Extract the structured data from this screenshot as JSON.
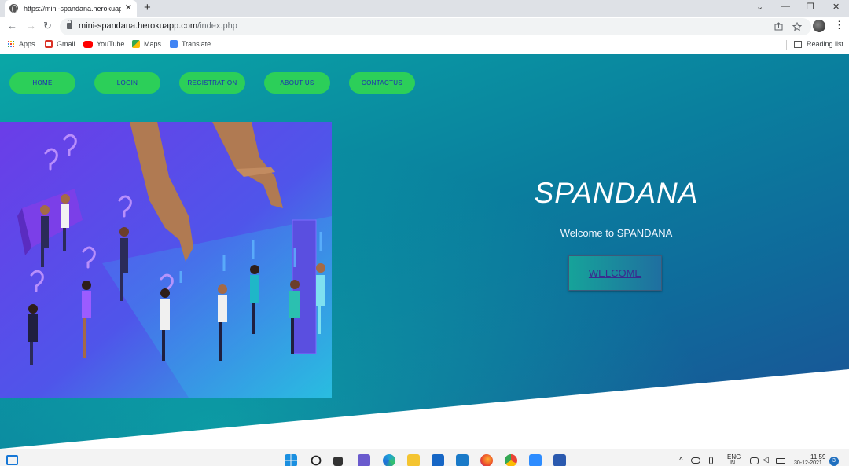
{
  "browser": {
    "tab_title": "https://mini-spandana.herokuapp",
    "tab_close": "✕",
    "new_tab": "+",
    "url_host": "mini-spandana.herokuapp.com",
    "url_path": "/index.php",
    "window_controls": [
      "⌄",
      "—",
      "❐",
      "✕"
    ],
    "nav_icons": [
      "←",
      "→",
      "↻"
    ],
    "omnibox_icons": [
      "share-icon",
      "star-icon"
    ],
    "bookmarks": [
      {
        "label": "Apps",
        "icon": "apps-grid-icon"
      },
      {
        "label": "Gmail",
        "icon": "gmail-icon",
        "color": "#d93025"
      },
      {
        "label": "YouTube",
        "icon": "youtube-icon",
        "color": "#ff0000"
      },
      {
        "label": "Maps",
        "icon": "maps-icon",
        "color": "#34a853"
      },
      {
        "label": "Translate",
        "icon": "translate-icon",
        "color": "#4285f4"
      }
    ],
    "reading_list": "Reading list"
  },
  "site": {
    "nav": [
      "HOME",
      "LOGIN",
      "REGISTRATION",
      "ABOUT US",
      "CONTACTUS"
    ],
    "title": "SPANDANA",
    "subtitle": "Welcome to SPANDANA",
    "welcome_button": "WELCOME",
    "colors": {
      "nav_pill": "#2ccf59",
      "nav_text": "#1e2bb5",
      "hero_bg_start": "#0aa7a6",
      "hero_bg_end": "#1c4f95",
      "illustration_bg": "#5b46e6"
    }
  },
  "taskbar": {
    "left_icon": "widgets-icon",
    "apps": [
      "windows-start-icon",
      "search-icon",
      "task-view-icon",
      "teams-chat-icon",
      "edge-icon",
      "file-explorer-icon",
      "mail-icon",
      "dell-icon",
      "firefox-icon",
      "chrome-icon",
      "zoom-icon",
      "word-icon"
    ],
    "language": "ENG",
    "language_sub": "IN",
    "time": "11:59",
    "date": "30-12-2021",
    "notification_count": "3"
  }
}
